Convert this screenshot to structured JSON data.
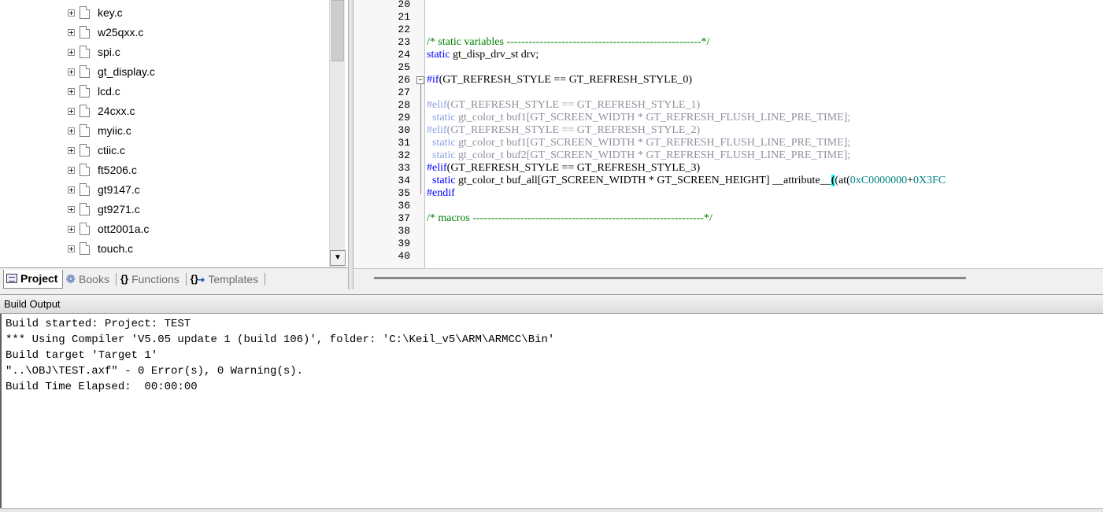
{
  "project_tree": {
    "files": [
      "key.c",
      "w25qxx.c",
      "spi.c",
      "gt_display.c",
      "lcd.c",
      "24cxx.c",
      "myiic.c",
      "ctiic.c",
      "ft5206.c",
      "gt9147.c",
      "gt9271.c",
      "ott2001a.c",
      "touch.c"
    ]
  },
  "panel_tabs": [
    {
      "label": "Project",
      "icon": "project-icon",
      "active": true
    },
    {
      "label": "Books",
      "icon": "books-icon",
      "active": false
    },
    {
      "label": "Functions",
      "icon": "braces-icon",
      "active": false
    },
    {
      "label": "Templates",
      "icon": "templates-icon",
      "active": false
    }
  ],
  "editor": {
    "line_numbers": [
      "20",
      "21",
      "22",
      "23",
      "24",
      "25",
      "26",
      "27",
      "28",
      "29",
      "30",
      "31",
      "32",
      "33",
      "34",
      "35",
      "36",
      "37",
      "38",
      "39",
      "40"
    ],
    "lines": [
      {
        "num": "20",
        "parts": []
      },
      {
        "num": "21",
        "parts": []
      },
      {
        "num": "22",
        "parts": []
      },
      {
        "num": "23",
        "parts": [
          {
            "t": "/* static variables -----------------------------------------------------*/",
            "c": "cm"
          }
        ]
      },
      {
        "num": "24",
        "parts": [
          {
            "t": "static",
            "c": "kw"
          },
          {
            "t": " gt_disp_drv_st drv;",
            "c": ""
          }
        ]
      },
      {
        "num": "25",
        "parts": []
      },
      {
        "num": "26",
        "parts": [
          {
            "t": "#if",
            "c": "pp"
          },
          {
            "t": "(GT_REFRESH_STYLE == GT_REFRESH_STYLE_0)",
            "c": ""
          }
        ]
      },
      {
        "num": "27",
        "parts": []
      },
      {
        "num": "28",
        "parts": [
          {
            "t": "#elif",
            "c": "dimkw"
          },
          {
            "t": "(GT_REFRESH_STYLE == GT_REFRESH_STYLE_1)",
            "c": "dim"
          }
        ]
      },
      {
        "num": "29",
        "parts": [
          {
            "t": "  static",
            "c": "dimkw"
          },
          {
            "t": " gt_color_t buf1[GT_SCREEN_WIDTH * GT_REFRESH_FLUSH_LINE_PRE_TIME];",
            "c": "dim"
          }
        ]
      },
      {
        "num": "30",
        "parts": [
          {
            "t": "#elif",
            "c": "dimkw"
          },
          {
            "t": "(GT_REFRESH_STYLE == GT_REFRESH_STYLE_2)",
            "c": "dim"
          }
        ]
      },
      {
        "num": "31",
        "parts": [
          {
            "t": "  static",
            "c": "dimkw"
          },
          {
            "t": " gt_color_t buf1[GT_SCREEN_WIDTH * GT_REFRESH_FLUSH_LINE_PRE_TIME];",
            "c": "dim"
          }
        ]
      },
      {
        "num": "32",
        "parts": [
          {
            "t": "  static",
            "c": "dimkw"
          },
          {
            "t": " gt_color_t buf2[GT_SCREEN_WIDTH * GT_REFRESH_FLUSH_LINE_PRE_TIME];",
            "c": "dim"
          }
        ]
      },
      {
        "num": "33",
        "parts": [
          {
            "t": "#elif",
            "c": "pp"
          },
          {
            "t": "(GT_REFRESH_STYLE == GT_REFRESH_STYLE_3)",
            "c": ""
          }
        ]
      },
      {
        "num": "34",
        "parts": [
          {
            "t": "  static",
            "c": "kw"
          },
          {
            "t": " gt_color_t buf_all[GT_SCREEN_WIDTH * GT_SCREEN_HEIGHT] __attribute__",
            "c": ""
          },
          {
            "t": "(",
            "c": "brace"
          },
          {
            "t": "(at(",
            "c": ""
          },
          {
            "t": "0xC0000000",
            "c": "num"
          },
          {
            "t": "+",
            "c": ""
          },
          {
            "t": "0X3FC",
            "c": "num"
          }
        ]
      },
      {
        "num": "35",
        "parts": [
          {
            "t": "#endif",
            "c": "pp"
          }
        ]
      },
      {
        "num": "36",
        "parts": []
      },
      {
        "num": "37",
        "parts": [
          {
            "t": "/* macros ---------------------------------------------------------------*/",
            "c": "cm"
          }
        ]
      },
      {
        "num": "38",
        "parts": []
      },
      {
        "num": "39",
        "parts": []
      },
      {
        "num": "40",
        "parts": []
      }
    ]
  },
  "build_output": {
    "title": "Build Output",
    "lines": [
      "Build started: Project: TEST",
      "*** Using Compiler 'V5.05 update 1 (build 106)', folder: 'C:\\Keil_v5\\ARM\\ARMCC\\Bin'",
      "Build target 'Target 1'",
      "\"..\\OBJ\\TEST.axf\" - 0 Error(s), 0 Warning(s).",
      "Build Time Elapsed:  00:00:00"
    ]
  }
}
